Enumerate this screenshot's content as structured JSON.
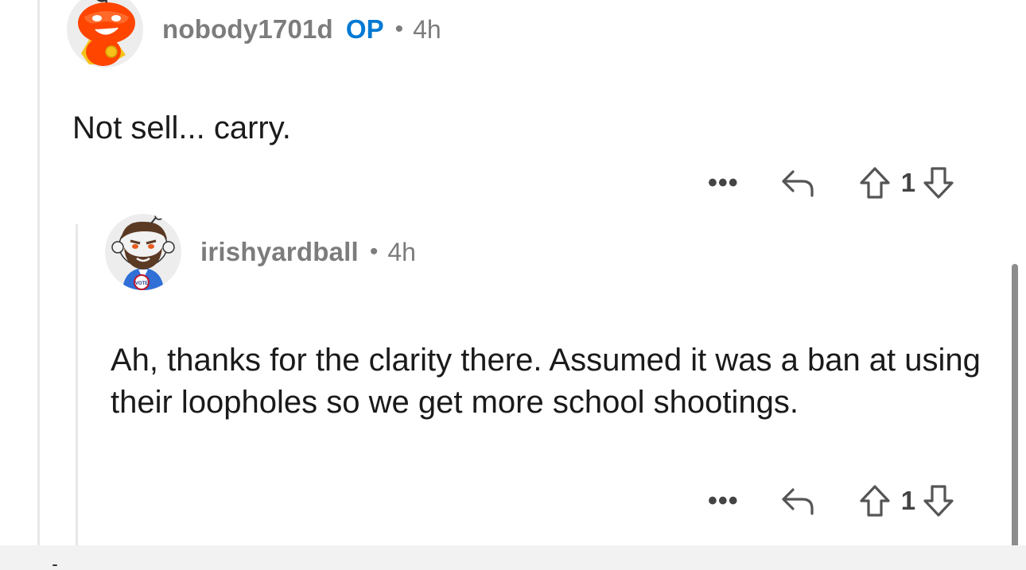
{
  "comments": [
    {
      "username": "nobody1701d",
      "badge": "OP",
      "separator": "•",
      "time": "4h",
      "body": "Not sell... carry.",
      "more": "•••",
      "score": "1",
      "avatar_icon": "snoo-superhero-avatar-icon"
    },
    {
      "username": "irishyardball",
      "separator": "•",
      "time": "4h",
      "body": "Ah, thanks for the clarity there. Assumed it was a ban at using their loopholes so we get more school shootings.",
      "more": "•••",
      "score": "1",
      "avatar_icon": "snoo-bearded-vote-avatar-icon",
      "avatar_badge": "VOTE"
    }
  ],
  "colors": {
    "op_badge": "#0079d3",
    "meta_text": "#7c7c7c",
    "thread_line": "#e8e8e8"
  }
}
